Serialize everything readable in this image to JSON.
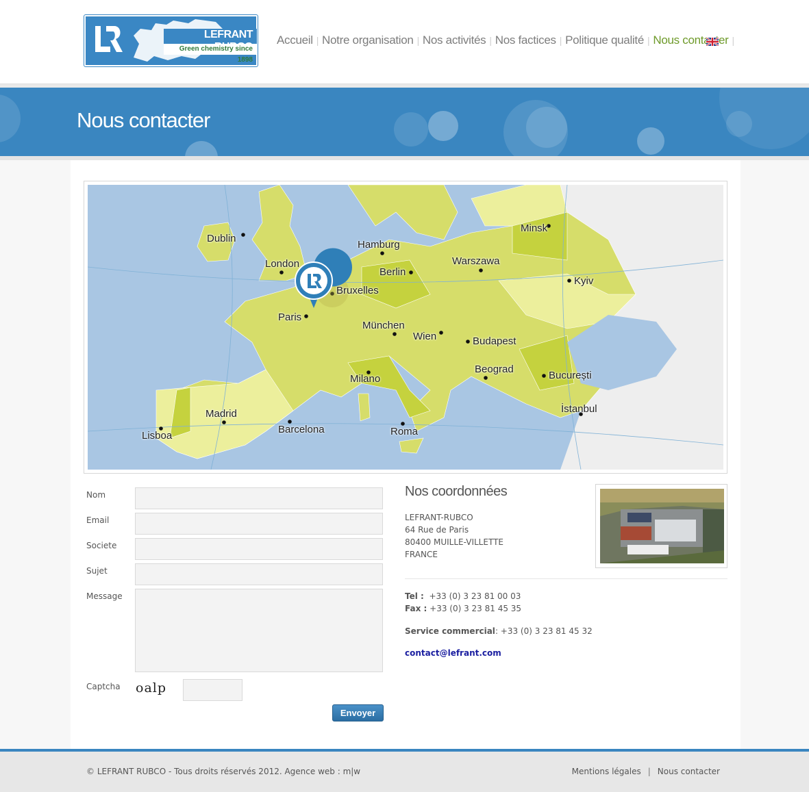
{
  "brand": {
    "name": "LEFRANT RUBCO",
    "tagline": "Green chemistry since 1898"
  },
  "nav": {
    "items": [
      "Accueil",
      "Notre organisation",
      "Nos activités",
      "Nos factices",
      "Politique qualité",
      "Nous contacter"
    ],
    "active": "Nous contacter",
    "language_icon": "uk-flag-icon"
  },
  "page": {
    "title": "Nous contacter"
  },
  "map": {
    "cities": [
      "Dublin",
      "London",
      "Hamburg",
      "Berlin",
      "Warszawa",
      "Minsk",
      "Kyiv",
      "Bruxelles",
      "Paris",
      "München",
      "Wien",
      "Budapest",
      "Beograd",
      "București",
      "Milano",
      "Madrid",
      "Barcelona",
      "Lisboa",
      "Roma",
      "İstanbul"
    ],
    "marker_icon": "location-pin-icon"
  },
  "form": {
    "labels": {
      "name": "Nom",
      "email": "Email",
      "company": "Societe",
      "subject": "Sujet",
      "message": "Message",
      "captcha": "Captcha"
    },
    "captcha_text": "oalp",
    "submit": "Envoyer"
  },
  "contact": {
    "title": "Nos coordonnées",
    "address": [
      "LEFRANT-RUBCO",
      "64 Rue de Paris",
      "80400 MUILLE-VILLETTE",
      "FRANCE"
    ],
    "tel_label": "Tel :",
    "tel": "+33  (0) 3 23 81 00 03",
    "fax_label": "Fax :",
    "fax": "+33  (0) 3 23 81 45 35",
    "sales_label": "Service commercial",
    "sales": ": +33 (0) 3 23 81 45 32",
    "email": "contact@lefrant.com"
  },
  "footer": {
    "copyright": "© LEFRANT RUBCO - Tous droits réservés 2012. Agence web : m|w",
    "links": [
      "Mentions légales",
      "Nous contacter"
    ],
    "separator": "|"
  },
  "colors": {
    "brand_blue": "#3a86c0",
    "nav_active": "#6e9a2a",
    "link": "#1a1ea0",
    "land": "#d6dd6a",
    "sea": "#a9c6e3"
  }
}
